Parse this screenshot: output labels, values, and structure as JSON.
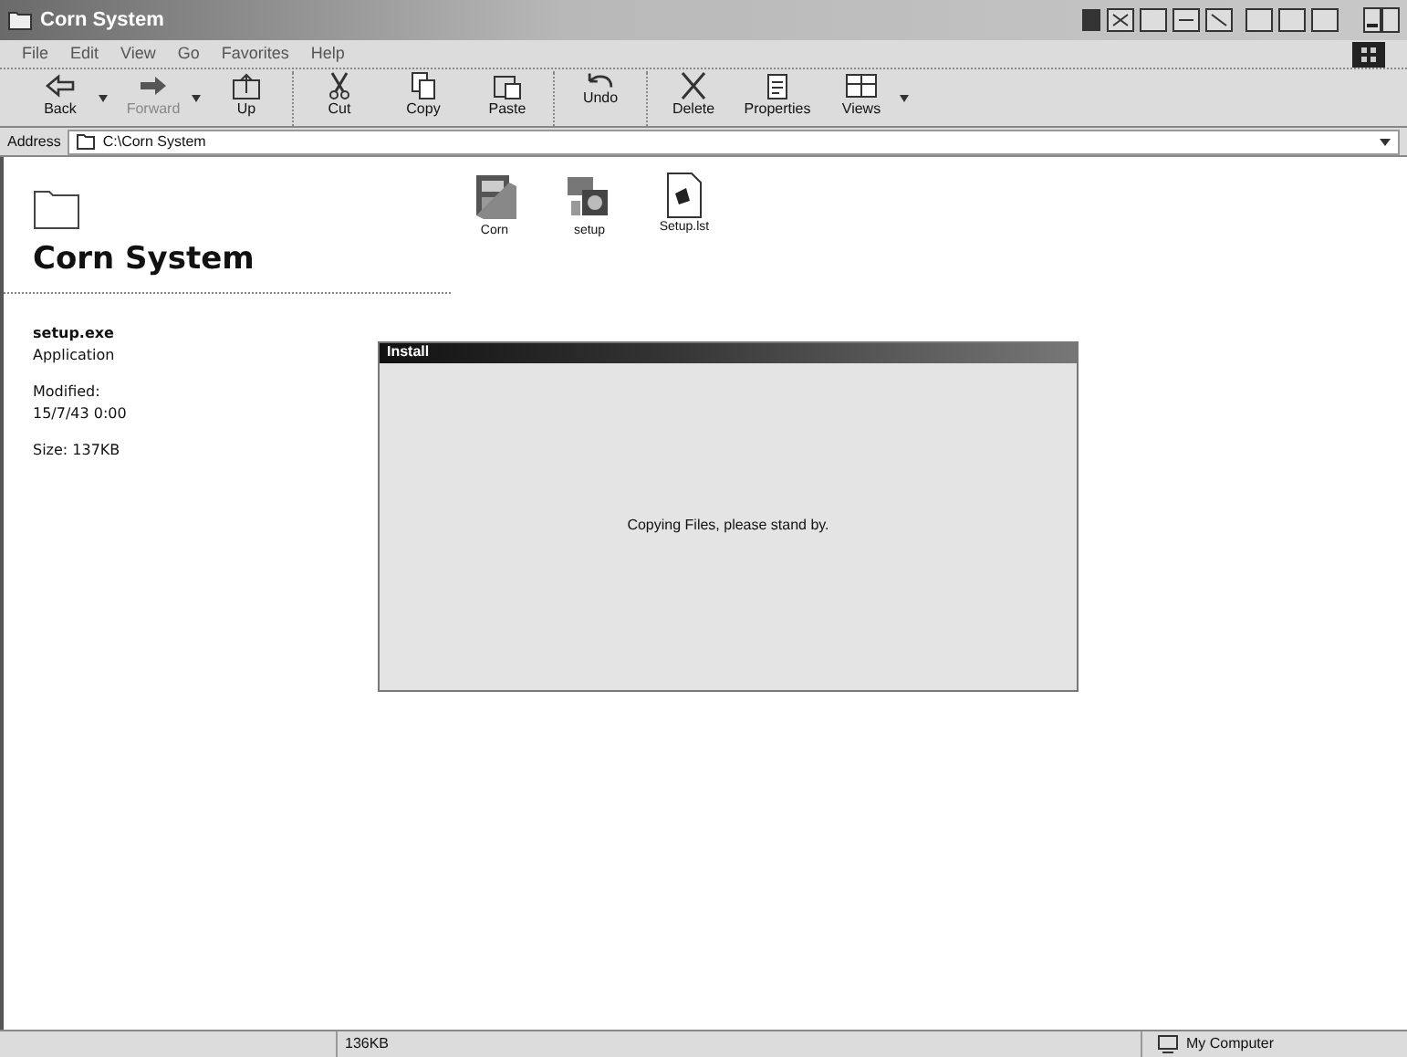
{
  "window": {
    "title": "Corn System"
  },
  "menu": [
    "File",
    "Edit",
    "View",
    "Go",
    "Favorites",
    "Help"
  ],
  "toolbar": [
    {
      "label": "Back",
      "disabled": false
    },
    {
      "label": "Forward",
      "disabled": true
    },
    {
      "label": "Up",
      "disabled": false
    },
    {
      "label": "Cut",
      "disabled": false
    },
    {
      "label": "Copy",
      "disabled": false
    },
    {
      "label": "Paste",
      "disabled": false
    },
    {
      "label": "Undo",
      "disabled": false
    },
    {
      "label": "Delete",
      "disabled": false
    },
    {
      "label": "Properties",
      "disabled": false
    },
    {
      "label": "Views",
      "disabled": false
    }
  ],
  "address": {
    "label": "Address",
    "value": "C:\\Corn System"
  },
  "folder_panel": {
    "title": "Corn System",
    "file_name": "setup.exe",
    "file_type": "Application",
    "modified_label": "Modified:",
    "modified": "15/7/43 0:00",
    "size": "Size: 137KB"
  },
  "files": [
    {
      "name": "Corn"
    },
    {
      "name": "setup"
    },
    {
      "name": "Setup.lst"
    }
  ],
  "dialog": {
    "title": "Install",
    "message": "Copying Files, please stand by."
  },
  "status_bar": {
    "size": "136KB",
    "zone": "My Computer"
  }
}
